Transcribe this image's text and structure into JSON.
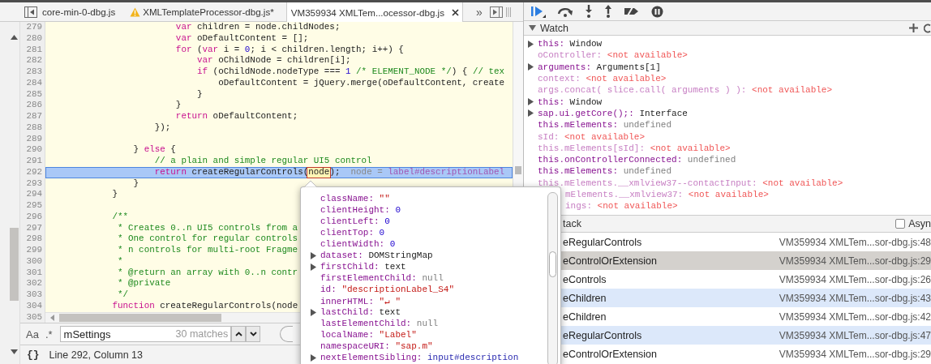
{
  "editor_tabs": {
    "tabs": [
      {
        "label": "core-min-0-dbg.js",
        "selected": false,
        "warning": false
      },
      {
        "label": "XMLTemplateProcessor-dbg.js*",
        "selected": false,
        "warning": true
      },
      {
        "label": "VM359934 XMLTem...ocessor-dbg.js",
        "selected": true,
        "warning": false
      }
    ],
    "overflow": "»"
  },
  "code_editor": {
    "lines": [
      {
        "number": "279",
        "current": false,
        "tokens": [
          {
            "text": "                        var",
            "kind": "keyword"
          },
          {
            "text": " children = node.childNodes;",
            "kind": "plain"
          }
        ]
      },
      {
        "number": "280",
        "current": false,
        "tokens": [
          {
            "text": "                        var",
            "kind": "keyword"
          },
          {
            "text": " oDefaultContent = [];",
            "kind": "plain"
          }
        ]
      },
      {
        "number": "281",
        "current": false,
        "tokens": [
          {
            "text": "                        for",
            "kind": "keyword"
          },
          {
            "text": " (",
            "kind": "plain"
          },
          {
            "text": "var",
            "kind": "keyword"
          },
          {
            "text": " i = ",
            "kind": "plain"
          },
          {
            "text": "0",
            "kind": "number"
          },
          {
            "text": "; i < children.length; i++) {",
            "kind": "plain"
          }
        ]
      },
      {
        "number": "282",
        "current": false,
        "tokens": [
          {
            "text": "                            var",
            "kind": "keyword"
          },
          {
            "text": " oChildNode = children[i];",
            "kind": "plain"
          }
        ]
      },
      {
        "number": "283",
        "current": false,
        "tokens": [
          {
            "text": "                            if",
            "kind": "keyword"
          },
          {
            "text": " (oChildNode.nodeType === ",
            "kind": "plain"
          },
          {
            "text": "1",
            "kind": "number"
          },
          {
            "text": " /* ELEMENT_NODE */",
            "kind": "comment"
          },
          {
            "text": ") { ",
            "kind": "plain"
          },
          {
            "text": "// tex",
            "kind": "comment"
          }
        ]
      },
      {
        "number": "284",
        "current": false,
        "tokens": [
          {
            "text": "                                oDefaultContent = jQuery.merge(oDefaultContent, create",
            "kind": "plain"
          }
        ]
      },
      {
        "number": "285",
        "current": false,
        "tokens": [
          {
            "text": "                            }",
            "kind": "plain"
          }
        ]
      },
      {
        "number": "286",
        "current": false,
        "tokens": [
          {
            "text": "                        }",
            "kind": "plain"
          }
        ]
      },
      {
        "number": "287",
        "current": false,
        "tokens": [
          {
            "text": "                        return",
            "kind": "keyword"
          },
          {
            "text": " oDefaultContent;",
            "kind": "plain"
          }
        ]
      },
      {
        "number": "288",
        "current": false,
        "tokens": [
          {
            "text": "                    });",
            "kind": "plain"
          }
        ]
      },
      {
        "number": "289",
        "current": false
      },
      {
        "number": "290",
        "current": false,
        "tokens": [
          {
            "text": "                } ",
            "kind": "plain"
          },
          {
            "text": "else",
            "kind": "keyword"
          },
          {
            "text": " {",
            "kind": "plain"
          }
        ]
      },
      {
        "number": "291",
        "current": false,
        "tokens": [
          {
            "text": "                    // a plain and simple regular UI5 control",
            "kind": "comment"
          }
        ]
      },
      {
        "number": "292",
        "current": true,
        "tokens": [
          {
            "text": "                    return",
            "kind": "keyword"
          },
          {
            "text": " createRegularControls(",
            "kind": "plain"
          },
          {
            "text": "node",
            "kind": "hovered"
          },
          {
            "text": ");",
            "kind": "plain"
          },
          {
            "text": "node = ",
            "kind": "inline"
          },
          {
            "text": "label#descriptionLabel",
            "kind": "inline-node"
          }
        ]
      },
      {
        "number": "293",
        "current": false,
        "tokens": [
          {
            "text": "                }",
            "kind": "plain"
          }
        ]
      },
      {
        "number": "294",
        "current": false,
        "tokens": [
          {
            "text": "            }",
            "kind": "plain"
          }
        ]
      },
      {
        "number": "295",
        "current": false
      },
      {
        "number": "296",
        "current": false,
        "tokens": [
          {
            "text": "            /**",
            "kind": "comment"
          }
        ]
      },
      {
        "number": "297",
        "current": false,
        "tokens": [
          {
            "text": "             * Creates 0..n UI5 controls from a",
            "kind": "comment"
          }
        ]
      },
      {
        "number": "298",
        "current": false,
        "tokens": [
          {
            "text": "             * One control for regular controls",
            "kind": "comment"
          }
        ]
      },
      {
        "number": "299",
        "current": false,
        "tokens": [
          {
            "text": "             * n controls for multi-root Fragme",
            "kind": "comment"
          }
        ]
      },
      {
        "number": "300",
        "current": false,
        "tokens": [
          {
            "text": "             *",
            "kind": "comment"
          }
        ]
      },
      {
        "number": "301",
        "current": false,
        "tokens": [
          {
            "text": "             * @return an array with 0..n contr",
            "kind": "comment"
          }
        ]
      },
      {
        "number": "302",
        "current": false,
        "tokens": [
          {
            "text": "             * @private",
            "kind": "comment"
          }
        ]
      },
      {
        "number": "303",
        "current": false,
        "tokens": [
          {
            "text": "             */",
            "kind": "comment"
          }
        ]
      },
      {
        "number": "304",
        "current": false,
        "tokens": [
          {
            "text": "            function",
            "kind": "keyword"
          },
          {
            "text": " createRegularControls(node",
            "kind": "plain"
          }
        ]
      }
    ],
    "scrollbar_row_number": "305"
  },
  "search_bar": {
    "match_case": "Aa",
    "regex": ".*",
    "query": "mSettings",
    "match_count": "30 matches"
  },
  "status_bar": {
    "pretty_print": "{}",
    "cursor_position": "Line 292, Column 13"
  },
  "watch": {
    "title": "Watch",
    "expressions": [
      {
        "name": "this:",
        "value": "Window",
        "kind": "object",
        "expandable": true,
        "partly_hidden": false
      },
      {
        "name": "oController:",
        "value": "<not available>",
        "kind": "unavailable",
        "expandable": false,
        "partly_hidden": false
      },
      {
        "name": "arguments:",
        "value": "Arguments[1]",
        "kind": "object",
        "expandable": true,
        "partly_hidden": false
      },
      {
        "name": "context:",
        "value": "<not available>",
        "kind": "unavailable",
        "expandable": false,
        "partly_hidden": false
      },
      {
        "name": "args.concat( slice.call( arguments ) ):",
        "value": "<not available>",
        "kind": "unavailable",
        "expandable": false,
        "partly_hidden": false
      },
      {
        "name": "this:",
        "value": "Window",
        "kind": "object",
        "expandable": true,
        "partly_hidden": false
      },
      {
        "name": "sap.ui.getCore();:",
        "value": "Interface",
        "kind": "object",
        "expandable": true,
        "partly_hidden": false
      },
      {
        "name": "this.mElements:",
        "value": "undefined",
        "kind": "undefined",
        "expandable": false,
        "partly_hidden": false
      },
      {
        "name": "sId:",
        "value": "<not available>",
        "kind": "unavailable",
        "expandable": false,
        "partly_hidden": false
      },
      {
        "name": "this.mElements[sId]:",
        "value": "<not available>",
        "kind": "unavailable",
        "expandable": false,
        "partly_hidden": false
      },
      {
        "name": "this.onControllerConnected:",
        "value": "undefined",
        "kind": "undefined",
        "expandable": false,
        "partly_hidden": false
      },
      {
        "name": "this.mElements:",
        "value": "undefined",
        "kind": "undefined",
        "expandable": false,
        "partly_hidden": false
      },
      {
        "name": "this.mElements.__xmlview37--contactInput:",
        "value": "<not available>",
        "kind": "unavailable",
        "expandable": false,
        "partly_hidden": false
      },
      {
        "name": "mElements.__xmlview37:",
        "value": "<not available>",
        "kind": "unavailable",
        "expandable": false,
        "partly_hidden": true
      },
      {
        "name": "ings:",
        "value": "<not available>",
        "kind": "unavailable",
        "expandable": false,
        "partly_hidden": true
      }
    ]
  },
  "call_stack": {
    "title": "tack",
    "async_label": "Asyn",
    "async_checked": false,
    "frames": [
      {
        "function": "eRegularControls",
        "location": "VM359934 XMLTem...sor-dbg.js:48",
        "selected": false,
        "shaded": false
      },
      {
        "function": "eControlOrExtension",
        "location": "VM359934 XMLTem...sor-dbg.js:29",
        "selected": true,
        "shaded": false
      },
      {
        "function": "eControls",
        "location": "VM359934 XMLTem...sor-dbg.js:26",
        "selected": false,
        "shaded": false
      },
      {
        "function": "eChildren",
        "location": "VM359934 XMLTem...sor-dbg.js:43",
        "selected": false,
        "shaded": true
      },
      {
        "function": "eChildren",
        "location": "VM359934 XMLTem...sor-dbg.js:42",
        "selected": false,
        "shaded": false
      },
      {
        "function": "eRegularControls",
        "location": "VM359934 XMLTem...sor-dbg.js:47",
        "selected": false,
        "shaded": true
      },
      {
        "function": "eControlOrExtension",
        "location": "VM359934 XMLTem...sor-dbg.js:29",
        "selected": false,
        "shaded": false
      }
    ]
  },
  "hover_popover": {
    "properties": [
      {
        "name": "className:",
        "value": "\"\"",
        "kind": "string",
        "expandable": false
      },
      {
        "name": "clientHeight:",
        "value": "0",
        "kind": "number",
        "expandable": false
      },
      {
        "name": "clientLeft:",
        "value": "0",
        "kind": "number",
        "expandable": false
      },
      {
        "name": "clientTop:",
        "value": "0",
        "kind": "number",
        "expandable": false
      },
      {
        "name": "clientWidth:",
        "value": "0",
        "kind": "number",
        "expandable": false
      },
      {
        "name": "dataset:",
        "value": "DOMStringMap",
        "kind": "object",
        "expandable": true
      },
      {
        "name": "firstChild:",
        "value": "text",
        "kind": "object",
        "expandable": true
      },
      {
        "name": "firstElementChild:",
        "value": "null",
        "kind": "null",
        "expandable": false
      },
      {
        "name": "id:",
        "value": "\"descriptionLabel_S4\"",
        "kind": "string",
        "expandable": false
      },
      {
        "name": "innerHTML:",
        "value": "\"↵ \"",
        "kind": "string",
        "expandable": false
      },
      {
        "name": "lastChild:",
        "value": "text",
        "kind": "object",
        "expandable": true
      },
      {
        "name": "lastElementChild:",
        "value": "null",
        "kind": "null",
        "expandable": false
      },
      {
        "name": "localName:",
        "value": "\"Label\"",
        "kind": "string",
        "expandable": false
      },
      {
        "name": "namespaceURI:",
        "value": "\"sap.m\"",
        "kind": "string",
        "expandable": false
      },
      {
        "name": "nextElementSibling:",
        "value": "input#description",
        "kind": "node",
        "expandable": true
      }
    ]
  }
}
